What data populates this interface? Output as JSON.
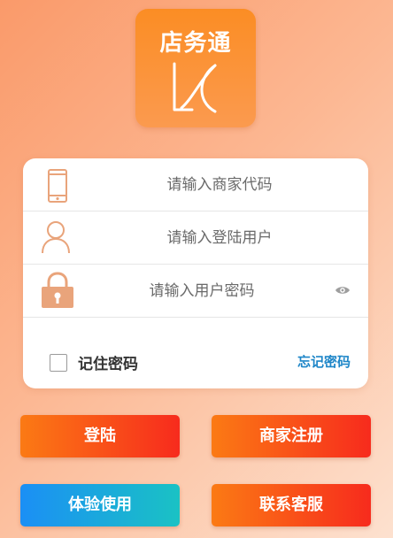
{
  "app": {
    "logo_title": "店务通"
  },
  "form": {
    "merchant_code_placeholder": "请输入商家代码",
    "username_placeholder": "请输入登陆用户",
    "password_placeholder": "请输入用户密码",
    "remember_label": "记住密码",
    "remember_checked": false,
    "forgot_label": "忘记密码"
  },
  "buttons": {
    "login": "登陆",
    "register": "商家注册",
    "trial": "体验使用",
    "contact": "联系客服"
  },
  "icons": [
    "phone-icon",
    "user-icon",
    "lock-icon",
    "eye-icon",
    "brand-mark-icon"
  ],
  "colors": {
    "accent_orange": "#fb8d24",
    "link_blue": "#1e86c8",
    "icon_orange": "#e9a47b",
    "button_red": "#f72b1d",
    "button_blue": "#1b8ff5"
  }
}
